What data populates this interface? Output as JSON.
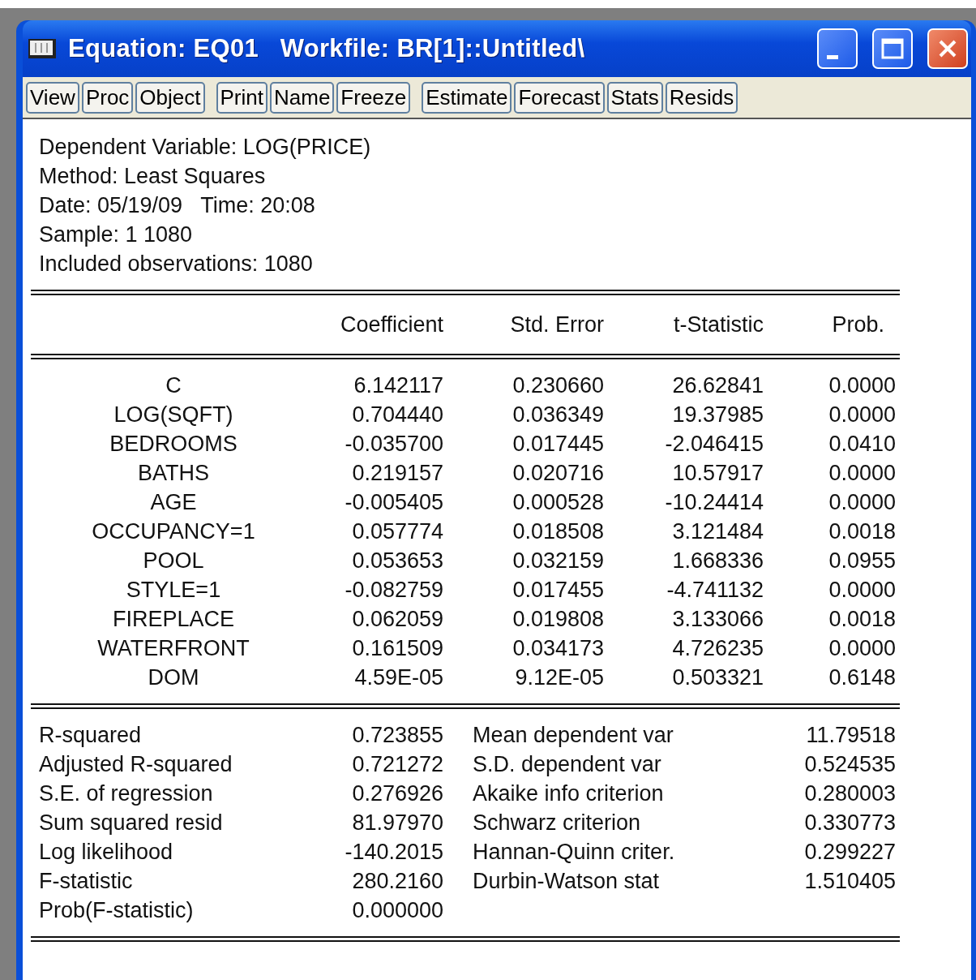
{
  "window": {
    "title": "Equation: EQ01   Workfile: BR[1]::Untitled\\"
  },
  "toolbar": [
    [
      "View",
      "Proc",
      "Object"
    ],
    [
      "Print",
      "Name",
      "Freeze"
    ],
    [
      "Estimate",
      "Forecast",
      "Stats",
      "Resids"
    ]
  ],
  "info": [
    "Dependent Variable: LOG(PRICE)",
    "Method: Least Squares",
    "Date: 05/19/09   Time: 20:08",
    "Sample: 1 1080",
    "Included observations: 1080"
  ],
  "table": {
    "columns": [
      "",
      "Coefficient",
      "Std. Error",
      "t-Statistic",
      "Prob."
    ],
    "rows": [
      [
        "C",
        "6.142117",
        "0.230660",
        "26.62841",
        "0.0000"
      ],
      [
        "LOG(SQFT)",
        "0.704440",
        "0.036349",
        "19.37985",
        "0.0000"
      ],
      [
        "BEDROOMS",
        "-0.035700",
        "0.017445",
        "-2.046415",
        "0.0410"
      ],
      [
        "BATHS",
        "0.219157",
        "0.020716",
        "10.57917",
        "0.0000"
      ],
      [
        "AGE",
        "-0.005405",
        "0.000528",
        "-10.24414",
        "0.0000"
      ],
      [
        "OCCUPANCY=1",
        "0.057774",
        "0.018508",
        "3.121484",
        "0.0018"
      ],
      [
        "POOL",
        "0.053653",
        "0.032159",
        "1.668336",
        "0.0955"
      ],
      [
        "STYLE=1",
        "-0.082759",
        "0.017455",
        "-4.741132",
        "0.0000"
      ],
      [
        "FIREPLACE",
        "0.062059",
        "0.019808",
        "3.133066",
        "0.0018"
      ],
      [
        "WATERFRONT",
        "0.161509",
        "0.034173",
        "4.726235",
        "0.0000"
      ],
      [
        "DOM",
        "4.59E-05",
        "9.12E-05",
        "0.503321",
        "0.6148"
      ]
    ]
  },
  "statistics": [
    [
      "R-squared",
      "0.723855",
      "Mean dependent var",
      "11.79518"
    ],
    [
      "Adjusted R-squared",
      "0.721272",
      "S.D. dependent var",
      "0.524535"
    ],
    [
      "S.E. of regression",
      "0.276926",
      "Akaike info criterion",
      "0.280003"
    ],
    [
      "Sum squared resid",
      "81.97970",
      "Schwarz criterion",
      "0.330773"
    ],
    [
      "Log likelihood",
      "-140.2015",
      "Hannan-Quinn criter.",
      "0.299227"
    ],
    [
      "F-statistic",
      "280.2160",
      "Durbin-Watson stat",
      "1.510405"
    ],
    [
      "Prob(F-statistic)",
      "0.000000"
    ]
  ]
}
